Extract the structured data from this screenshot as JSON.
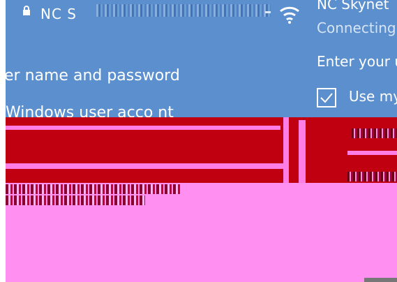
{
  "network_panel": {
    "name": "NC S",
    "sign_in_heading": "er name and password",
    "account_option": "Windows user acco  nt"
  },
  "network_flyout": {
    "ssid": "NC Skynet",
    "status": "Connecting",
    "prompt": "Enter your u",
    "checkbox_label": "Use my"
  },
  "icons": {
    "lock": "lock-icon",
    "wifi": "wifi-icon",
    "checkbox": "checkbox-icon"
  },
  "colors": {
    "accent_blue": "#5b8fce",
    "glitch_red": "#c00010",
    "glitch_pink": "#ff8ff0"
  }
}
